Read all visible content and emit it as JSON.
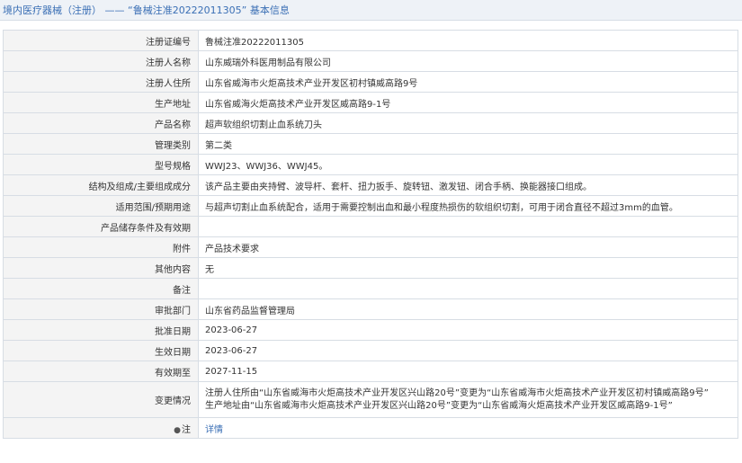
{
  "header": {
    "title": "境内医疗器械（注册） ——  “鲁械注准20222011305” 基本信息"
  },
  "rows": [
    {
      "label": "注册证编号",
      "value": "鲁械注准20222011305"
    },
    {
      "label": "注册人名称",
      "value": "山东威瑞外科医用制品有限公司"
    },
    {
      "label": "注册人住所",
      "value": "山东省威海市火炬高技术产业开发区初村镇威高路9号"
    },
    {
      "label": "生产地址",
      "value": "山东省威海火炬高技术产业开发区威高路9-1号"
    },
    {
      "label": "产品名称",
      "value": "超声软组织切割止血系统刀头"
    },
    {
      "label": "管理类别",
      "value": "第二类"
    },
    {
      "label": "型号规格",
      "value": "WWJ23、WWJ36、WWJ45。"
    },
    {
      "label": "结构及组成/主要组成成分",
      "value": "该产品主要由夹持臂、波导杆、套杆、扭力扳手、旋转钮、激发钮、闭合手柄、换能器接口组成。"
    },
    {
      "label": "适用范围/预期用途",
      "value": "与超声切割止血系统配合，适用于需要控制出血和最小程度热损伤的软组织切割，可用于闭合直径不超过3mm的血管。"
    },
    {
      "label": "产品储存条件及有效期",
      "value": ""
    },
    {
      "label": "附件",
      "value": "产品技术要求"
    },
    {
      "label": "其他内容",
      "value": "无"
    },
    {
      "label": "备注",
      "value": ""
    },
    {
      "label": "审批部门",
      "value": "山东省药品监督管理局"
    },
    {
      "label": "批准日期",
      "value": "2023-06-27"
    },
    {
      "label": "生效日期",
      "value": "2023-06-27"
    },
    {
      "label": "有效期至",
      "value": "2027-11-15"
    }
  ],
  "changes": {
    "label": "变更情况",
    "lines": [
      "注册人住所由“山东省威海市火炬高技术产业开发区兴山路20号”变更为“山东省威海市火炬高技术产业开发区初村镇威高路9号”",
      "生产地址由“山东省威海市火炬高技术产业开发区兴山路20号”变更为“山东省威海火炬高技术产业开发区威高路9-1号”"
    ]
  },
  "detail": {
    "icon": "help-icon",
    "label": "注",
    "link_text": "详情"
  }
}
